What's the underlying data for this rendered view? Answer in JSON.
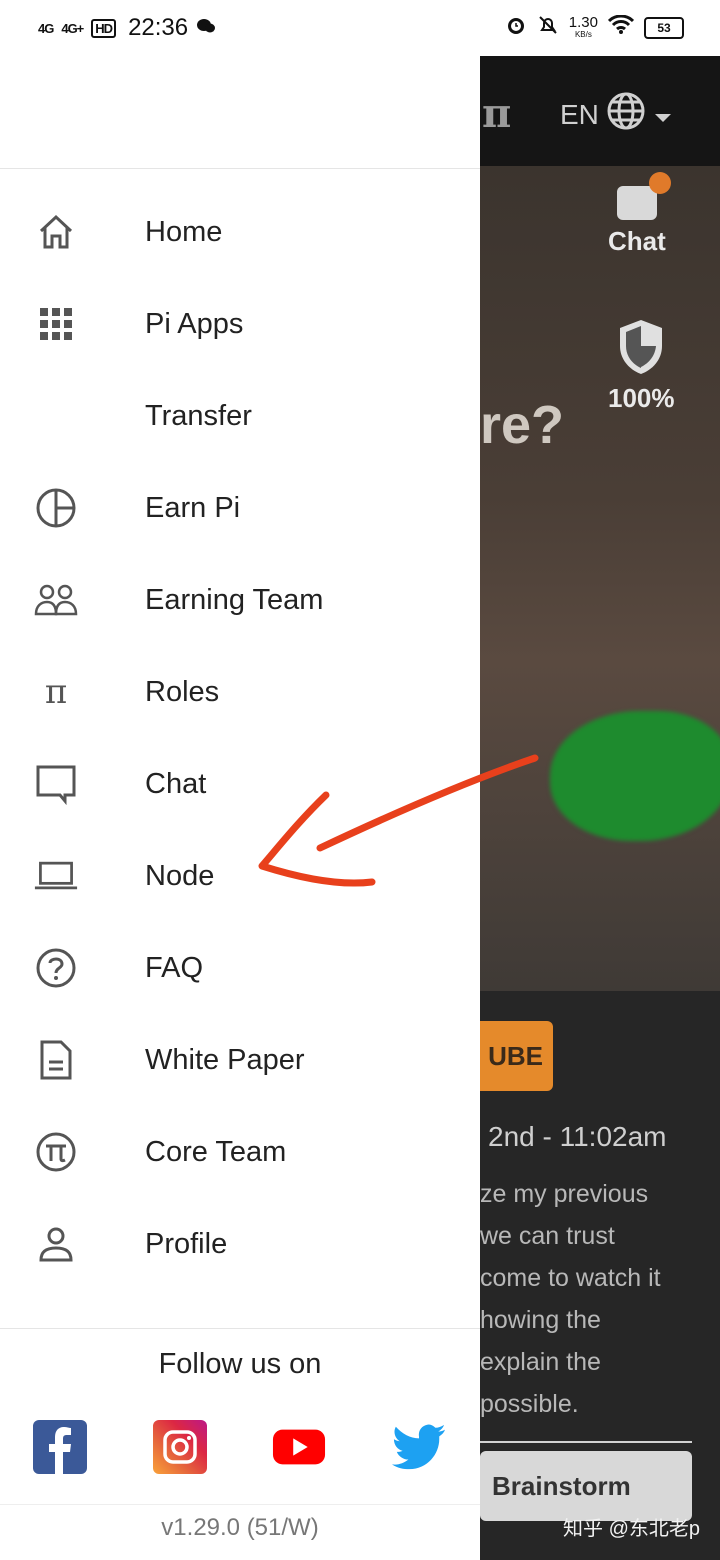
{
  "status_bar": {
    "signal1": "4G",
    "signal2": "4G+",
    "hd": "HD",
    "time": "22:36",
    "speed_value": "1.30",
    "speed_unit": "KB/s",
    "battery": "53"
  },
  "background_app": {
    "language": "EN",
    "chat_label": "Chat",
    "security_percent": "100%",
    "big_text": "re?",
    "youtube_partial": "UBE",
    "date_partial": "2nd - 11:02am",
    "text_lines": [
      "ze my previous",
      "we can trust",
      "come to watch it",
      "howing the",
      "explain the",
      "possible."
    ],
    "brainstorm_label": "Brainstorm"
  },
  "drawer": {
    "menu": [
      {
        "label": "Home",
        "icon": "home-icon"
      },
      {
        "label": "Pi Apps",
        "icon": "grid-icon"
      },
      {
        "label": "Transfer",
        "icon": ""
      },
      {
        "label": "Earn Pi",
        "icon": "pie-icon"
      },
      {
        "label": "Earning Team",
        "icon": "team-icon"
      },
      {
        "label": "Roles",
        "icon": "pi-symbol-icon"
      },
      {
        "label": "Chat",
        "icon": "chat-icon"
      },
      {
        "label": "Node",
        "icon": "laptop-icon"
      },
      {
        "label": "FAQ",
        "icon": "help-icon"
      },
      {
        "label": "White Paper",
        "icon": "document-icon"
      },
      {
        "label": "Core Team",
        "icon": "pi-circle-icon"
      },
      {
        "label": "Profile",
        "icon": "person-icon"
      }
    ],
    "follow_title": "Follow us on",
    "social": [
      "facebook",
      "instagram",
      "youtube",
      "twitter"
    ],
    "version": "v1.29.0 (51/W)"
  },
  "watermark": "知乎 @东北老p",
  "colors": {
    "annotation_arrow": "#e8401c",
    "facebook": "#3b5998",
    "youtube": "#ff0000",
    "twitter": "#1da1f2"
  }
}
